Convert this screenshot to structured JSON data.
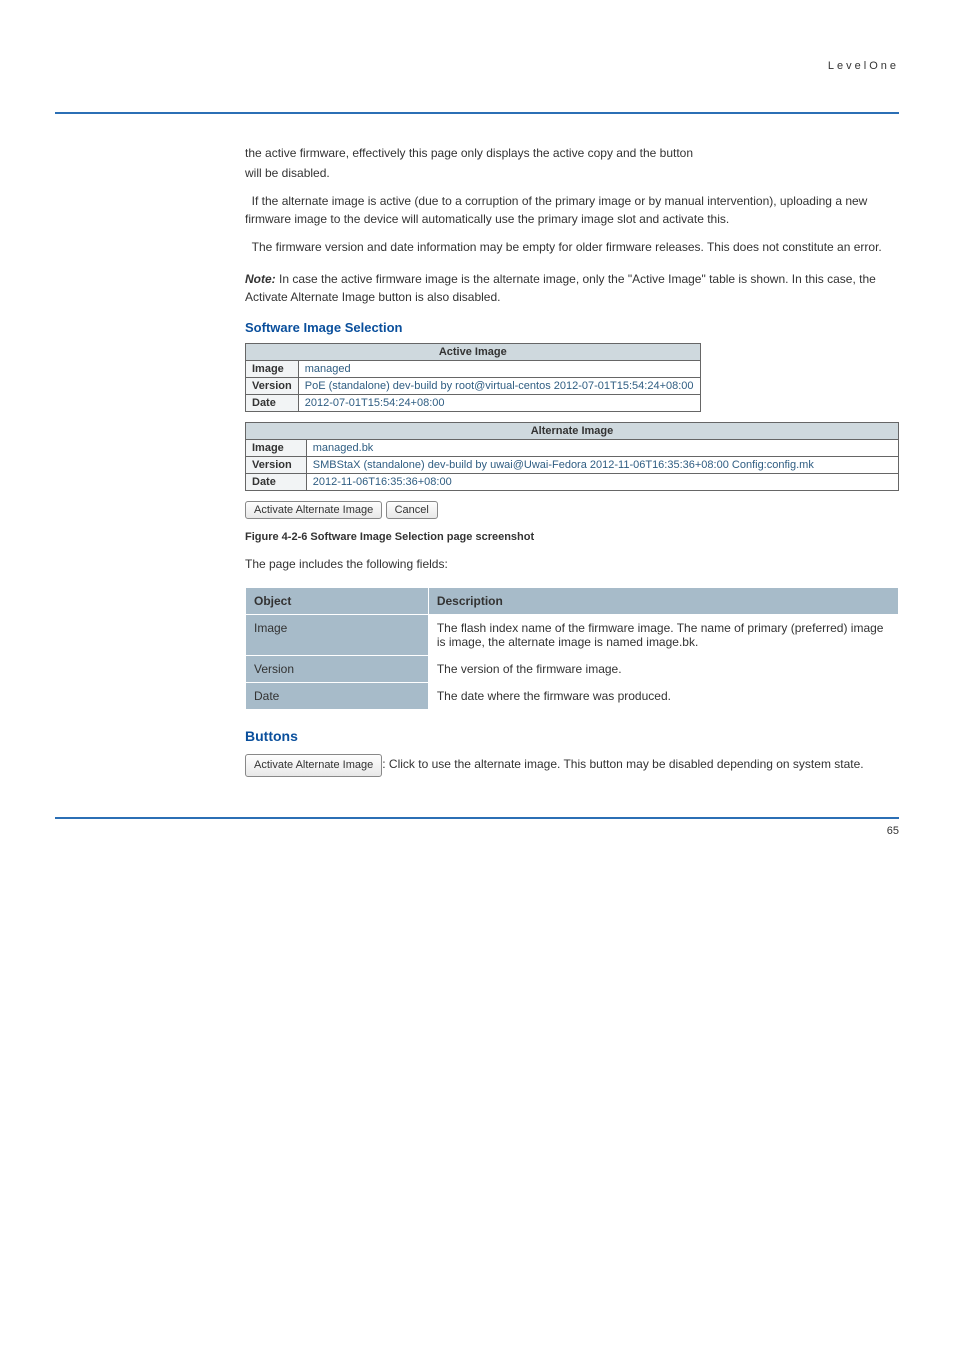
{
  "header": {
    "brand": "LevelOne"
  },
  "intro": {
    "line1": "the active firmware, effectively this page only displays the active copy and the button",
    "line2": "will be disabled."
  },
  "intro2": "  If the alternate image is active (due to a corruption of the primary image or by manual intervention), uploading a new firmware image to the device will automatically use the primary image slot and activate this.",
  "intro3": "  The firmware version and date information may be empty for older firmware releases. This does not constitute an error.",
  "note": {
    "label": "Note:",
    "text": "In case the active firmware image is the alternate image, only the \"Active Image\" table is shown. In this case, the Activate Alternate Image button is also disabled."
  },
  "screenshot": {
    "title": "Software Image Selection",
    "active": {
      "header": "Active Image",
      "rows": [
        {
          "k": "Image",
          "v": "managed"
        },
        {
          "k": "Version",
          "v": "PoE (standalone) dev-build by root@virtual-centos 2012-07-01T15:54:24+08:00"
        },
        {
          "k": "Date",
          "v": "2012-07-01T15:54:24+08:00"
        }
      ]
    },
    "alternate": {
      "header": "Alternate Image",
      "rows": [
        {
          "k": "Image",
          "v": "managed.bk"
        },
        {
          "k": "Version",
          "v": "SMBStaX (standalone) dev-build by uwai@Uwai-Fedora 2012-11-06T16:35:36+08:00 Config:config.mk"
        },
        {
          "k": "Date",
          "v": "2012-11-06T16:35:36+08:00"
        }
      ]
    },
    "buttons": {
      "activate": "Activate Alternate Image",
      "cancel": "Cancel"
    }
  },
  "figure": {
    "caption": "Figure 4-2-6 Software Image Selection page screenshot"
  },
  "paramIntro": "The page includes the following fields:",
  "paramTable": {
    "headers": [
      "Object",
      "Description"
    ],
    "rows": [
      {
        "obj": "Image",
        "desc": "The flash index name of the firmware image. The name of primary (preferred) image is image, the alternate image is named image.bk."
      },
      {
        "obj": "Version",
        "desc": "The version of the firmware image."
      },
      {
        "obj": "Date",
        "desc": "The date where the firmware was produced."
      }
    ]
  },
  "buttonsTitle": "Buttons",
  "buttonsDesc": {
    "prefix": "Activate Alternate Image",
    "rest": ": Click to use the alternate image. This button may be disabled depending on system state."
  },
  "footer": {
    "page": "65"
  }
}
